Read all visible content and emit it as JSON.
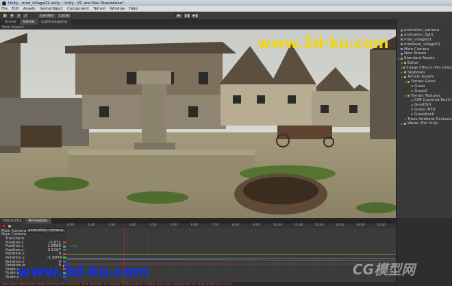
{
  "window": {
    "title": "Unity - med_village01.unity - Unity - PC and Mac Standalone*"
  },
  "menu": [
    "File",
    "Edit",
    "Assets",
    "GameObject",
    "Component",
    "Terrain",
    "Window",
    "Help"
  ],
  "toolbar": {
    "tools": [
      "hand-icon",
      "move-icon",
      "rotate-icon",
      "scale-icon"
    ],
    "pivot_label": "Center",
    "space_label": "Local",
    "play_icons": [
      "play-icon",
      "pause-icon",
      "step-icon"
    ]
  },
  "scene_tabs": [
    "Scene",
    "Game",
    "Lightmapping"
  ],
  "scene_subbar": {
    "aspect": "Free Aspect"
  },
  "watermark_top": "www.3d-ku.com",
  "hierarchy": {
    "items": [
      {
        "label": "animation_camera",
        "depth": 0,
        "icon": "obj"
      },
      {
        "label": "animation_light",
        "depth": 0,
        "icon": "obj"
      },
      {
        "label": "med_village01",
        "depth": 0,
        "icon": "obj"
      },
      {
        "label": "medieval_village01",
        "depth": 0,
        "icon": "obj"
      },
      {
        "label": "Main Camera",
        "depth": 0,
        "icon": "obj"
      },
      {
        "label": "New Terrain",
        "depth": 0,
        "icon": "obj"
      },
      {
        "label": "Standard Assets",
        "depth": 0,
        "icon": "folder",
        "open": true
      },
      {
        "label": "Editor",
        "depth": 1,
        "icon": "folder"
      },
      {
        "label": "Image Effects (Pro Only)",
        "depth": 1,
        "icon": "folder"
      },
      {
        "label": "Skyboxes",
        "depth": 1,
        "icon": "folder"
      },
      {
        "label": "Terrain Assets",
        "depth": 1,
        "icon": "folder",
        "open": true
      },
      {
        "label": "Terrain Grass",
        "depth": 2,
        "icon": "folder",
        "open": true
      },
      {
        "label": "Grass",
        "depth": 3,
        "icon": "tex"
      },
      {
        "label": "Grass2",
        "depth": 3,
        "icon": "tex"
      },
      {
        "label": "Terrain Textures",
        "depth": 2,
        "icon": "folder",
        "open": true
      },
      {
        "label": "Cliff (Layered Rock)",
        "depth": 3,
        "icon": "tex"
      },
      {
        "label": "GoodDirt",
        "depth": 3,
        "icon": "tex"
      },
      {
        "label": "Grass (Hill)",
        "depth": 3,
        "icon": "tex"
      },
      {
        "label": "GrassRock",
        "depth": 3,
        "icon": "tex"
      },
      {
        "label": "Trees Ambient-Occlusion",
        "depth": 2,
        "icon": "folder"
      },
      {
        "label": "Water (Pro Only)",
        "depth": 1,
        "icon": "folder"
      }
    ]
  },
  "animation": {
    "tabs": [
      "Hierarchy",
      "Animation"
    ],
    "clip_name": "animation_camera",
    "ruler_labels": [
      "0:00",
      "1:00",
      "2:00",
      "3:00",
      "4:00",
      "5:00",
      "6:00",
      "7:00",
      "8:00",
      "9:00",
      "10:00",
      "11:00",
      "12:00",
      "13:00",
      "14:00",
      "15:00"
    ],
    "frame_readout": "1:00",
    "tracks": [
      {
        "label": "Main Camera",
        "value": "",
        "color": ""
      },
      {
        "label": "Main Camera",
        "value": "",
        "color": ""
      },
      {
        "label": "Transform",
        "value": "",
        "color": ""
      },
      {
        "label": "Position.x",
        "value": "-5.072",
        "color": "#d04040"
      },
      {
        "label": "Position.y",
        "value": "1.8500",
        "color": "#40c040"
      },
      {
        "label": "Position.z",
        "value": "3.5267",
        "color": "#4060e0"
      },
      {
        "label": "Rotation.x",
        "value": "0",
        "color": "#d04040"
      },
      {
        "label": "Rotation.y",
        "value": "-1.8974",
        "color": "#40c040"
      },
      {
        "label": "Rotation.z",
        "value": "0",
        "color": "#4060e0"
      },
      {
        "label": "Rotation.w",
        "value": "0",
        "color": "#c0c0c0"
      },
      {
        "label": "Scale.x",
        "value": "",
        "color": "#d04040"
      },
      {
        "label": "Scale.y",
        "value": "",
        "color": "#40c040"
      },
      {
        "label": "Scale.z",
        "value": "",
        "color": "#4060e0"
      }
    ]
  },
  "status_text": "Standard Assets/Image Effects (Pro Only)/ The Shader of Image Effects/Sun shafts are not supported on this graphics card",
  "watermark_bottom": "www.3d-ku.com",
  "watermark_cg": "CG模型网"
}
